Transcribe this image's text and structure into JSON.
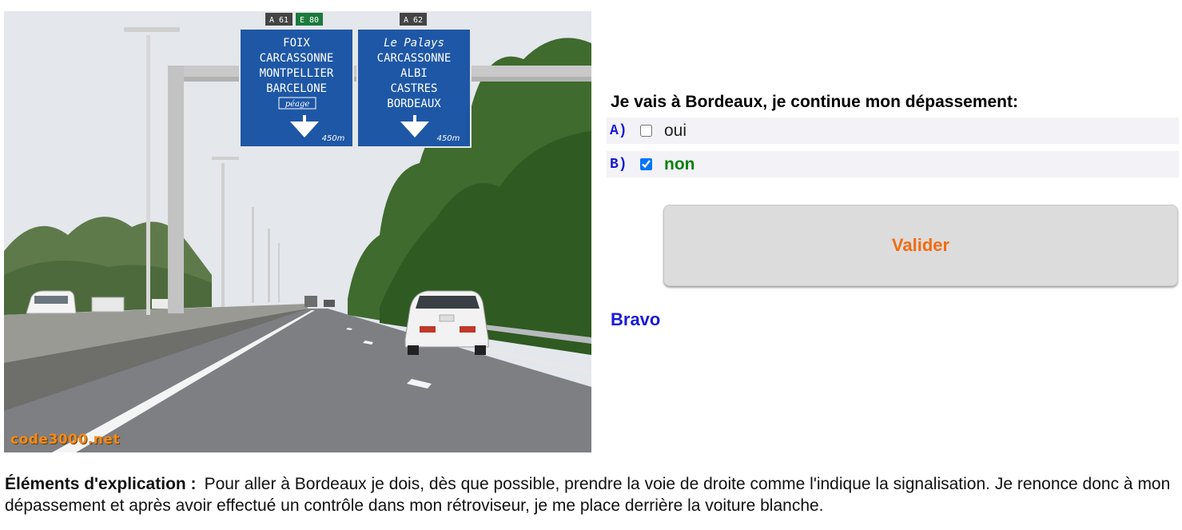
{
  "scene": {
    "image_description_icon": "motorway-scene-image",
    "shield_left_1": "A 61",
    "shield_left_2": "E 80",
    "shield_right": "A 62",
    "sign_left_lines": [
      "FOIX",
      "CARCASSONNE",
      "MONTPELLIER",
      "BARCELONE"
    ],
    "sign_left_toll": "péage",
    "sign_left_distance": "450m",
    "sign_right_lines": [
      "Le Palays",
      "CARCASSONNE",
      "ALBI",
      "CASTRES",
      "BORDEAUX"
    ],
    "sign_right_distance": "450m",
    "watermark": "code3000.net"
  },
  "quiz": {
    "question": "Je vais à Bordeaux, je continue mon dépassement:",
    "answers": [
      {
        "letter": "A)",
        "text": "oui",
        "checked": false
      },
      {
        "letter": "B)",
        "text": "non",
        "checked": true
      }
    ],
    "submit_label": "Valider",
    "result": "Bravo"
  },
  "explanation": {
    "label": "Éléments d'explication :",
    "text": "Pour aller à Bordeaux je dois, dès que possible, prendre la voie de droite comme l'indique la signalisation. Je renonce donc à mon dépassement et après avoir effectué un contrôle dans mon rétroviseur, je me place derrière la voiture blanche."
  },
  "colors": {
    "accent_blue": "#1a1ad6",
    "correct_green": "#0a7f0a",
    "button_text": "#f26b12",
    "sign_blue": "#1e57a6"
  }
}
